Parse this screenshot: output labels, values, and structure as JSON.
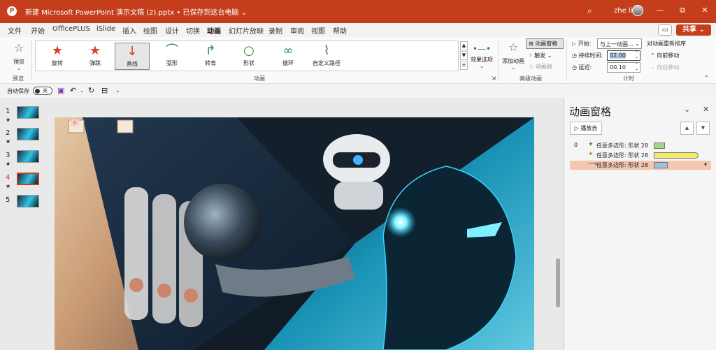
{
  "titlebar": {
    "logo": "P",
    "doc_title": "新建 Microsoft PowerPoint 演示文稿 (2).pptx • 已保存到这台电脑 ⌄",
    "user_name": "zhe li",
    "minimize": "—",
    "restore": "⧉",
    "close": "✕"
  },
  "menu": {
    "tabs": [
      "文件",
      "开始",
      "OfficePLUS",
      "iSlide",
      "插入",
      "绘图",
      "设计",
      "切换",
      "动画",
      "幻灯片放映",
      "录制",
      "审阅",
      "视图",
      "帮助"
    ],
    "active_tab": "动画",
    "share_label": "共享 ⌄",
    "comment_icon": "comment-icon"
  },
  "ribbon": {
    "preview": {
      "label": "预览",
      "group": "预览"
    },
    "animations": [
      {
        "label": "旋转",
        "icon": "★",
        "color": "#d9412c"
      },
      {
        "label": "弹跳",
        "icon": "★",
        "color": "#d9412c"
      },
      {
        "label": "直线",
        "icon": "↓",
        "color": "#d9412c"
      },
      {
        "label": "弧形",
        "icon": "⌒",
        "color": "#2e8b3a"
      },
      {
        "label": "转弯",
        "icon": "↱",
        "color": "#2e8b3a"
      },
      {
        "label": "形状",
        "icon": "○",
        "color": "#2e8b3a"
      },
      {
        "label": "循环",
        "icon": "∞",
        "color": "#2e8b3a"
      },
      {
        "label": "自定义路径",
        "icon": "⌇",
        "color": "#2e8b3a"
      }
    ],
    "selected_animation": "直线",
    "animation_group": "动画",
    "effect_options": "效果选项",
    "add_animation": "添加动画",
    "animation_pane": "动画窗格",
    "trigger": "触发",
    "animation_brush": "动画刷",
    "advanced_group": "高级动画",
    "start_label": "开始:",
    "start_value": "与上一动画...",
    "duration_label": "持续时间:",
    "duration_value": "02.00",
    "delay_label": "延迟:",
    "delay_value": "00.10",
    "timing_group": "计时",
    "reorder_title": "对动画重新排序",
    "move_earlier": "向前移动",
    "move_later": "向后移动"
  },
  "qat": {
    "autosave_label": "自动保存",
    "autosave_state": "关"
  },
  "thumbnails": [
    {
      "num": "1",
      "star": "★"
    },
    {
      "num": "2",
      "star": "★"
    },
    {
      "num": "3",
      "star": "★"
    },
    {
      "num": "4",
      "star": "★"
    },
    {
      "num": "5",
      "star": ""
    }
  ],
  "active_slide": "4",
  "slide": {
    "tag": "0"
  },
  "pane": {
    "title": "动画窗格",
    "play_label": "播放自",
    "items": [
      {
        "index": "0",
        "icon": "✦",
        "icon_color": "#2e8b3a",
        "label": "任意多边形: 形状 28",
        "bar_color": "#9fd98a"
      },
      {
        "index": "",
        "icon": "✦",
        "icon_color": "#d47a1a",
        "label": "任意多边形: 形状 28",
        "bar_color": "#f6e96b"
      },
      {
        "index": "",
        "icon": "⟶",
        "icon_color": "#555555",
        "label": "任意多边形: 形状 28",
        "bar_color": "#9ec3e0"
      }
    ]
  }
}
